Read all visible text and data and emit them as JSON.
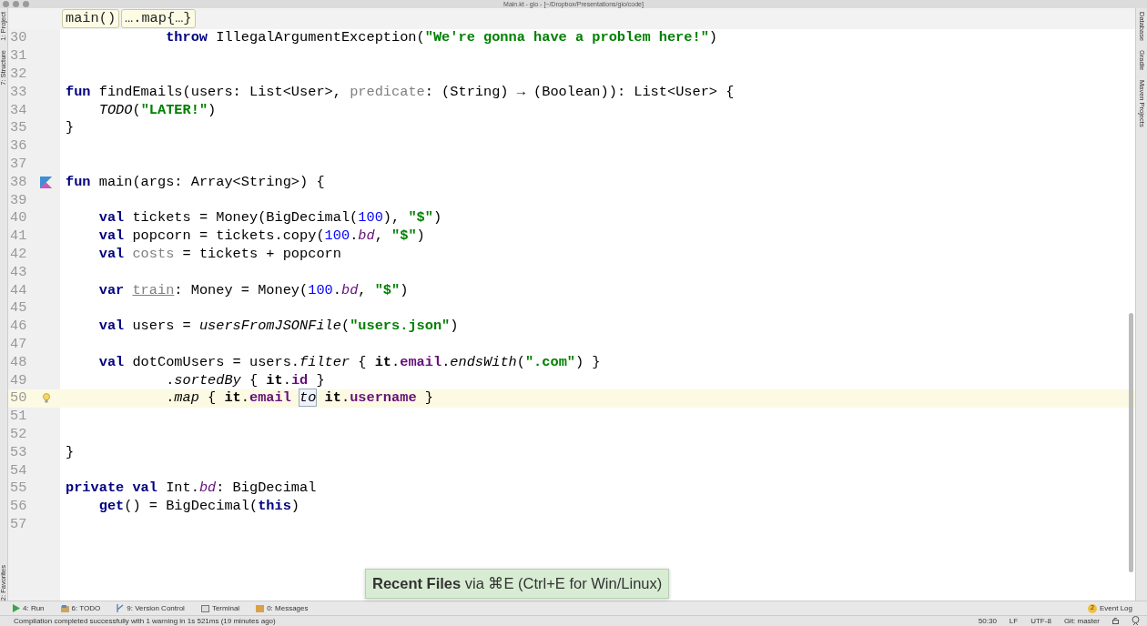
{
  "window": {
    "title": "Main.kt - gio - [~/Dropbox/Presentations/gio/code]"
  },
  "left_stripe": [
    {
      "label": "1: Project"
    },
    {
      "label": "7: Structure"
    },
    {
      "label": "2: Favorites"
    }
  ],
  "right_stripe": [
    {
      "label": "Database"
    },
    {
      "label": "Gradle"
    },
    {
      "label": "Maven Projects"
    }
  ],
  "breadcrumbs": [
    "main()",
    "….map{…}"
  ],
  "lines": [
    {
      "number": "30",
      "current": false,
      "tokens": [
        {
          "t": "            throw",
          "kind": "kw"
        },
        {
          "t": " IllegalArgumentException(",
          "kind": "plain"
        },
        {
          "t": "\"We're gonna have a problem here!\"",
          "kind": "str"
        },
        {
          "t": ")",
          "kind": "plain"
        }
      ]
    },
    {
      "number": "31",
      "current": false
    },
    {
      "number": "32",
      "current": false
    },
    {
      "number": "33",
      "current": false,
      "tokens": [
        {
          "t": "fun",
          "kind": "kw"
        },
        {
          "t": " findEmails(users: List<User>, ",
          "kind": "plain"
        },
        {
          "t": "predicate",
          "kind": "param"
        },
        {
          "t": ": (String) → (Boolean)): List<User> {",
          "kind": "plain"
        }
      ]
    },
    {
      "number": "34",
      "current": false,
      "tokens": [
        {
          "t": "    TODO",
          "kind": "fn"
        },
        {
          "t": "(",
          "kind": "plain"
        },
        {
          "t": "\"LATER!\"",
          "kind": "str"
        },
        {
          "t": ")",
          "kind": "plain"
        }
      ]
    },
    {
      "number": "35",
      "current": false,
      "tokens": [
        {
          "t": "}",
          "kind": "plain"
        }
      ]
    },
    {
      "number": "36",
      "current": false
    },
    {
      "number": "37",
      "current": false
    },
    {
      "number": "38",
      "current": false,
      "gutter_marker": {
        "kind": "run"
      },
      "tokens": [
        {
          "t": "fun",
          "kind": "kw"
        },
        {
          "t": " main(args: Array<String>) {",
          "kind": "plain"
        }
      ]
    },
    {
      "number": "39",
      "current": false
    },
    {
      "number": "40",
      "current": false,
      "tokens": [
        {
          "t": "    val",
          "kind": "kw"
        },
        {
          "t": " tickets = Money(BigDecimal(",
          "kind": "plain"
        },
        {
          "t": "100",
          "kind": "num"
        },
        {
          "t": "), ",
          "kind": "plain"
        },
        {
          "t": "\"$\"",
          "kind": "str"
        },
        {
          "t": ")",
          "kind": "plain"
        }
      ]
    },
    {
      "number": "41",
      "current": false,
      "tokens": [
        {
          "t": "    val",
          "kind": "kw"
        },
        {
          "t": " popcorn = tickets.copy(",
          "kind": "plain"
        },
        {
          "t": "100",
          "kind": "num"
        },
        {
          "t": ".",
          "kind": "plain"
        },
        {
          "t": "bd",
          "kind": "ext"
        },
        {
          "t": ", ",
          "kind": "plain"
        },
        {
          "t": "\"$\"",
          "kind": "str"
        },
        {
          "t": ")",
          "kind": "plain"
        }
      ]
    },
    {
      "number": "42",
      "current": false,
      "tokens": [
        {
          "t": "    val ",
          "kind": "kw"
        },
        {
          "t": "costs",
          "kind": "unused"
        },
        {
          "t": " = tickets + popcorn",
          "kind": "plain"
        }
      ]
    },
    {
      "number": "43",
      "current": false
    },
    {
      "number": "44",
      "current": false,
      "tokens": [
        {
          "t": "    var ",
          "kind": "kw"
        },
        {
          "t": "train",
          "kind": "underline"
        },
        {
          "t": ": Money = Money(",
          "kind": "plain"
        },
        {
          "t": "100",
          "kind": "num"
        },
        {
          "t": ".",
          "kind": "plain"
        },
        {
          "t": "bd",
          "kind": "ext"
        },
        {
          "t": ", ",
          "kind": "plain"
        },
        {
          "t": "\"$\"",
          "kind": "str"
        },
        {
          "t": ")",
          "kind": "plain"
        }
      ]
    },
    {
      "number": "45",
      "current": false
    },
    {
      "number": "46",
      "current": false,
      "tokens": [
        {
          "t": "    val",
          "kind": "kw"
        },
        {
          "t": " users = ",
          "kind": "plain"
        },
        {
          "t": "usersFromJSONFile",
          "kind": "fn"
        },
        {
          "t": "(",
          "kind": "plain"
        },
        {
          "t": "\"users.json\"",
          "kind": "str"
        },
        {
          "t": ")",
          "kind": "plain"
        }
      ]
    },
    {
      "number": "47",
      "current": false
    },
    {
      "number": "48",
      "current": false,
      "tokens": [
        {
          "t": "    val",
          "kind": "kw"
        },
        {
          "t": " dotComUsers = users.",
          "kind": "plain"
        },
        {
          "t": "filter",
          "kind": "fn"
        },
        {
          "t": " { ",
          "kind": "plain"
        },
        {
          "t": "it",
          "kind": "it"
        },
        {
          "t": ".",
          "kind": "plain"
        },
        {
          "t": "email",
          "kind": "prop"
        },
        {
          "t": ".",
          "kind": "plain"
        },
        {
          "t": "endsWith",
          "kind": "fn"
        },
        {
          "t": "(",
          "kind": "plain"
        },
        {
          "t": "\".com\"",
          "kind": "str"
        },
        {
          "t": ") }",
          "kind": "plain"
        }
      ]
    },
    {
      "number": "49",
      "current": false,
      "tokens": [
        {
          "t": "            .",
          "kind": "plain"
        },
        {
          "t": "sortedBy",
          "kind": "fn"
        },
        {
          "t": " { ",
          "kind": "plain"
        },
        {
          "t": "it",
          "kind": "it"
        },
        {
          "t": ".",
          "kind": "plain"
        },
        {
          "t": "id",
          "kind": "prop"
        },
        {
          "t": " }",
          "kind": "plain"
        }
      ]
    },
    {
      "number": "50",
      "current": true,
      "gutter_marker": {
        "kind": "bulb"
      },
      "tokens": [
        {
          "t": "            .",
          "kind": "plain"
        },
        {
          "t": "map",
          "kind": "fn"
        },
        {
          "t": " { ",
          "kind": "plain"
        },
        {
          "t": "it",
          "kind": "it"
        },
        {
          "t": ".",
          "kind": "plain"
        },
        {
          "t": "email ",
          "kind": "prop"
        },
        {
          "t": "to",
          "kind": "infix"
        },
        {
          "t": " it",
          "kind": "it"
        },
        {
          "t": ".",
          "kind": "plain"
        },
        {
          "t": "username",
          "kind": "prop"
        },
        {
          "t": " }",
          "kind": "plain"
        }
      ]
    },
    {
      "number": "51",
      "current": false
    },
    {
      "number": "52",
      "current": false
    },
    {
      "number": "53",
      "current": false,
      "tokens": [
        {
          "t": "}",
          "kind": "plain"
        }
      ]
    },
    {
      "number": "54",
      "current": false
    },
    {
      "number": "55",
      "current": false,
      "tokens": [
        {
          "t": "private val",
          "kind": "kw"
        },
        {
          "t": " Int.",
          "kind": "plain"
        },
        {
          "t": "bd",
          "kind": "ext"
        },
        {
          "t": ": BigDecimal",
          "kind": "plain"
        }
      ]
    },
    {
      "number": "56",
      "current": false,
      "tokens": [
        {
          "t": "    get",
          "kind": "kw"
        },
        {
          "t": "() = BigDecimal(",
          "kind": "plain"
        },
        {
          "t": "this",
          "kind": "kw"
        },
        {
          "t": ")",
          "kind": "plain"
        }
      ]
    },
    {
      "number": "57",
      "current": false
    }
  ],
  "tooltip": "**Recent Files** via ⌘E (Ctrl+E for Win/Linux)",
  "tool_windows": [
    {
      "label": "4: Run",
      "kind": "run"
    },
    {
      "label": "6: TODO",
      "kind": "todo"
    },
    {
      "label": "9: Version Control",
      "kind": "vcs"
    },
    {
      "label": "Terminal",
      "kind": "terminal"
    },
    {
      "label": "0: Messages",
      "kind": "messages"
    }
  ],
  "event_log": {
    "badge": "2",
    "label": "Event Log"
  },
  "status_bar": {
    "message": "Compilation completed successfully with 1 warning in 1s 521ms (19 minutes ago)",
    "position": "50:30",
    "line_separator": "LF",
    "encoding": "UTF-8",
    "vcs": "Git: master"
  }
}
